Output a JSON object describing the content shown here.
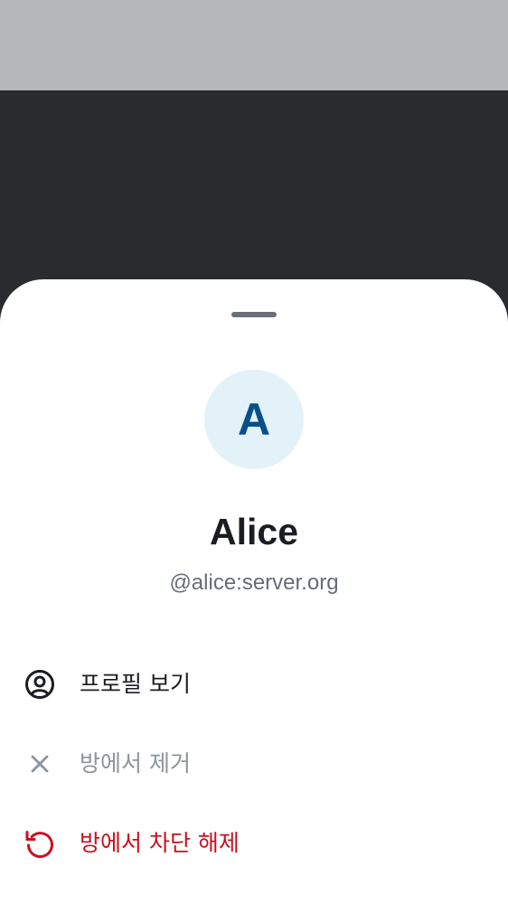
{
  "profile": {
    "avatar_initial": "A",
    "display_name": "Alice",
    "user_id": "@alice:server.org"
  },
  "actions": [
    {
      "label": "프로필 보기",
      "icon": "user-profile-icon",
      "state": "default"
    },
    {
      "label": "방에서 제거",
      "icon": "close-icon",
      "state": "disabled"
    },
    {
      "label": "방에서 차단 해제",
      "icon": "undo-icon",
      "state": "critical"
    }
  ],
  "colors": {
    "scrim": "#2a2b2e",
    "status_area": "#b6b7b9",
    "sheet_background": "#ffffff",
    "avatar_background": "#e2f2f8",
    "avatar_text": "#0a4f8a",
    "primary_text": "#1b1d22",
    "secondary_text": "#656d77",
    "disabled_text": "#8e949b",
    "critical": "#c9101f"
  }
}
